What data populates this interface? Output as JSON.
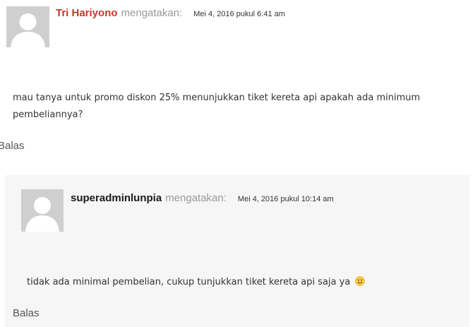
{
  "comments": [
    {
      "author": "Tri Hariyono",
      "says": "mengatakan:",
      "date": "Mei 4, 2016 pukul 6:41 am",
      "text": "mau tanya untuk promo diskon 25% menunjukkan tiket kereta api apakah ada minimum pembeliannya?",
      "reply_label": "Balas",
      "author_color": "#c0392b"
    },
    {
      "author": "superadminlunpia",
      "says": "mengatakan:",
      "date": "Mei 4, 2016 pukul 10:14 am",
      "text": "tidak ada minimal pembelian, cukup tunjukkan tiket kereta api saja ya",
      "emoji": "slightly-smiling-face-icon",
      "reply_label": "Balas"
    }
  ]
}
